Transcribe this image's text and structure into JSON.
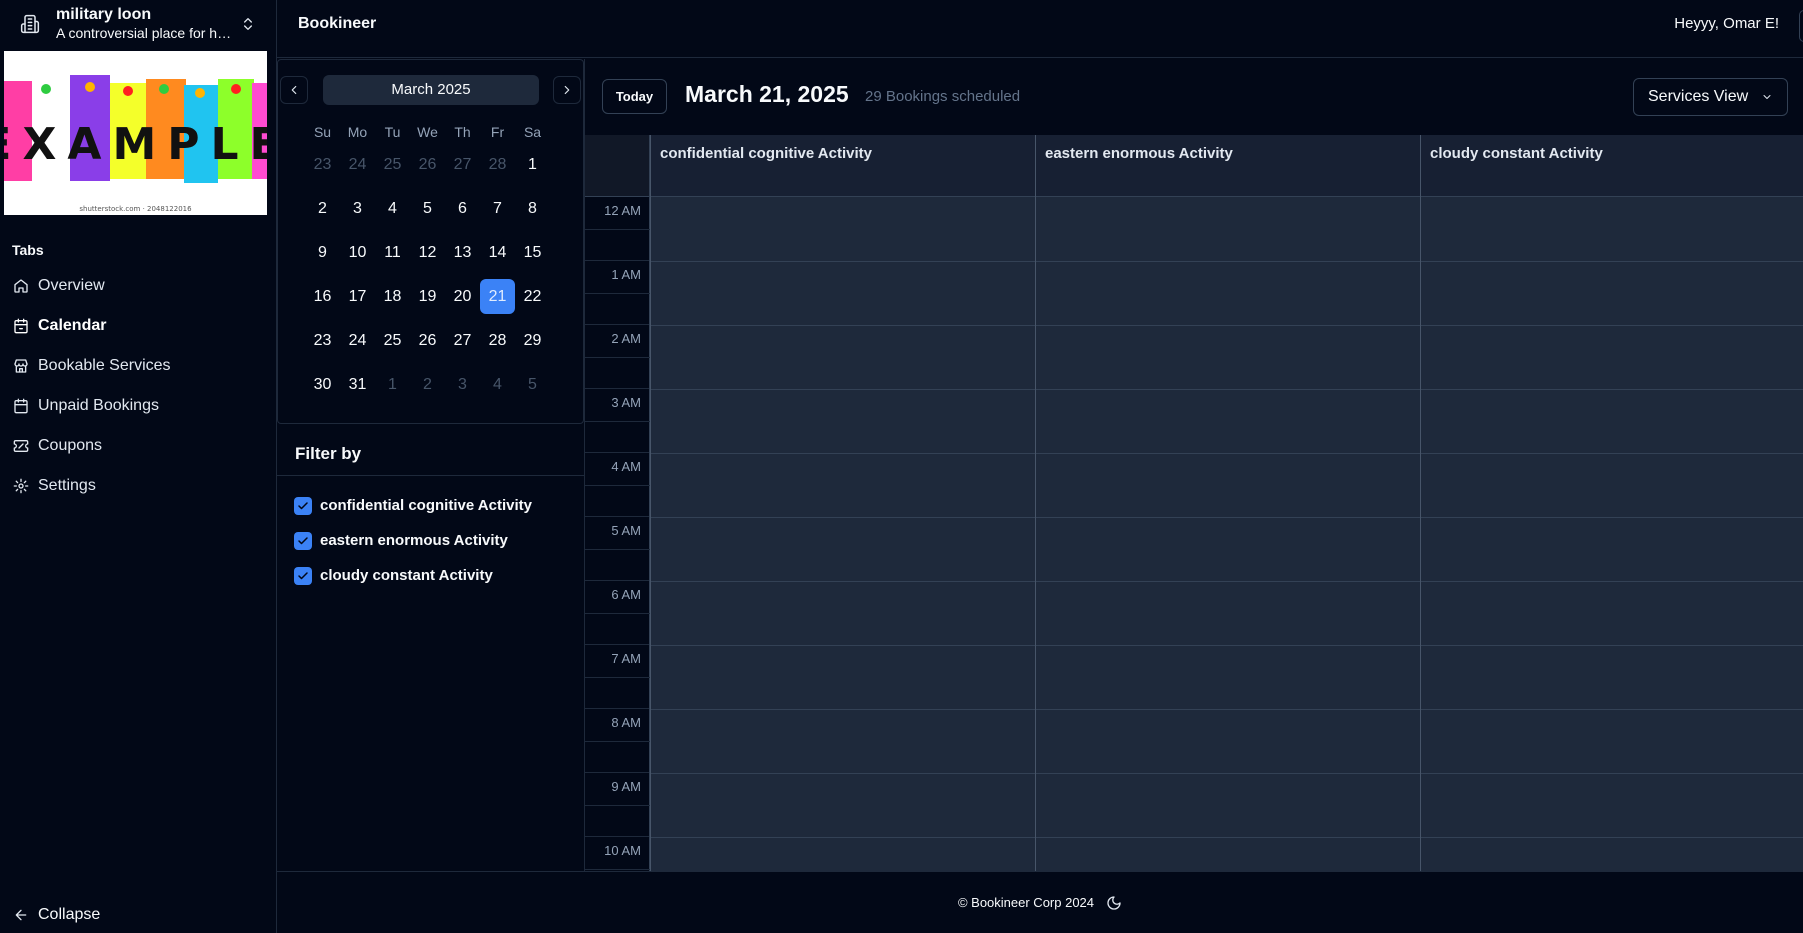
{
  "org": {
    "name": "military loon",
    "tagline": "A controversial place for ha...",
    "banner_text": "EXAMPLE",
    "banner_credit": "shutterstock.com · 2048122016"
  },
  "sidebar": {
    "section_label": "Tabs",
    "items": [
      {
        "label": "Overview",
        "icon": "home-icon"
      },
      {
        "label": "Calendar",
        "icon": "calendar-icon"
      },
      {
        "label": "Bookable Services",
        "icon": "store-icon"
      },
      {
        "label": "Unpaid Bookings",
        "icon": "calendar-icon"
      },
      {
        "label": "Coupons",
        "icon": "ticket-icon"
      },
      {
        "label": "Settings",
        "icon": "gear-icon"
      }
    ],
    "active_index": 1,
    "collapse_label": "Collapse"
  },
  "header": {
    "brand": "Bookineer",
    "greeting": "Heyyy, Omar E!"
  },
  "mini_calendar": {
    "month_label": "March 2025",
    "weekdays": [
      "Su",
      "Mo",
      "Tu",
      "We",
      "Th",
      "Fr",
      "Sa"
    ],
    "weeks": [
      [
        {
          "d": "23",
          "m": true
        },
        {
          "d": "24",
          "m": true
        },
        {
          "d": "25",
          "m": true
        },
        {
          "d": "26",
          "m": true
        },
        {
          "d": "27",
          "m": true
        },
        {
          "d": "28",
          "m": true
        },
        {
          "d": "1"
        }
      ],
      [
        {
          "d": "2"
        },
        {
          "d": "3"
        },
        {
          "d": "4"
        },
        {
          "d": "5"
        },
        {
          "d": "6"
        },
        {
          "d": "7"
        },
        {
          "d": "8"
        }
      ],
      [
        {
          "d": "9"
        },
        {
          "d": "10"
        },
        {
          "d": "11"
        },
        {
          "d": "12"
        },
        {
          "d": "13"
        },
        {
          "d": "14"
        },
        {
          "d": "15"
        }
      ],
      [
        {
          "d": "16"
        },
        {
          "d": "17"
        },
        {
          "d": "18"
        },
        {
          "d": "19"
        },
        {
          "d": "20"
        },
        {
          "d": "21",
          "s": true
        },
        {
          "d": "22"
        }
      ],
      [
        {
          "d": "23"
        },
        {
          "d": "24"
        },
        {
          "d": "25"
        },
        {
          "d": "26"
        },
        {
          "d": "27"
        },
        {
          "d": "28"
        },
        {
          "d": "29"
        }
      ],
      [
        {
          "d": "30"
        },
        {
          "d": "31"
        },
        {
          "d": "1",
          "m": true
        },
        {
          "d": "2",
          "m": true
        },
        {
          "d": "3",
          "m": true
        },
        {
          "d": "4",
          "m": true
        },
        {
          "d": "5",
          "m": true
        }
      ]
    ]
  },
  "filter": {
    "title": "Filter by",
    "options": [
      {
        "label": "confidential cognitive Activity",
        "checked": true
      },
      {
        "label": "eastern enormous Activity",
        "checked": true
      },
      {
        "label": "cloudy constant Activity",
        "checked": true
      }
    ]
  },
  "toolbar": {
    "today_label": "Today",
    "date_title": "March 21, 2025",
    "booking_count": "29 Bookings scheduled",
    "view_label": "Services View"
  },
  "schedule": {
    "columns": [
      "confidential cognitive Activity",
      "eastern enormous Activity",
      "cloudy constant Activity"
    ],
    "hours": [
      "12 AM",
      "1 AM",
      "2 AM",
      "3 AM",
      "4 AM",
      "5 AM",
      "6 AM",
      "7 AM",
      "8 AM",
      "9 AM",
      "10 AM"
    ]
  },
  "footer": {
    "copyright": "© Bookineer Corp 2024"
  },
  "colors": {
    "background": "#020817",
    "accent": "#3b82f6",
    "grid": "#1e293b"
  }
}
